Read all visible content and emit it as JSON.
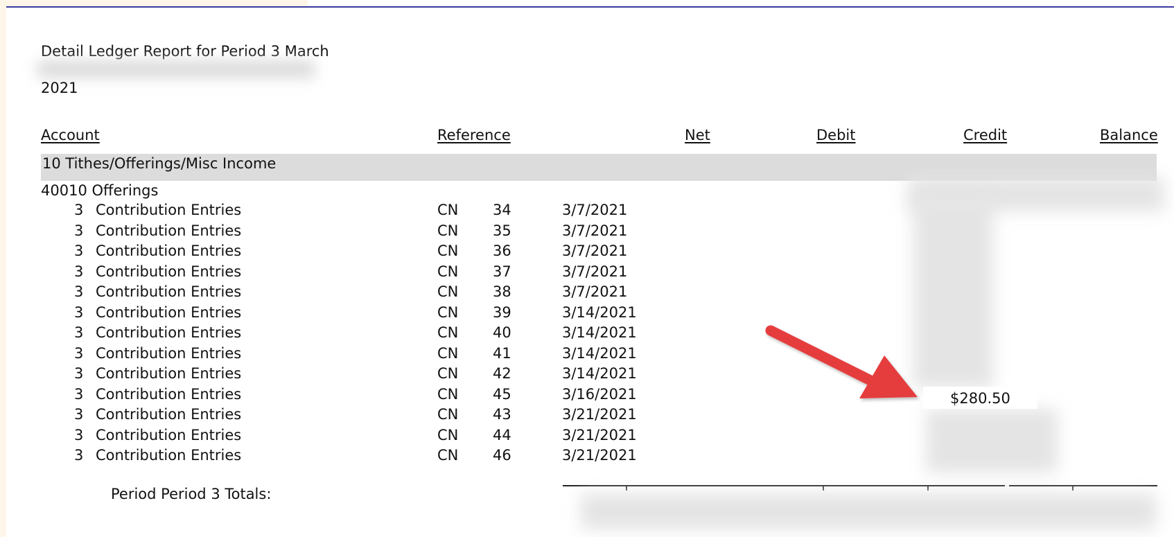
{
  "report": {
    "title": "Detail Ledger Report for Period 3 March",
    "year": "2021"
  },
  "columns": {
    "account": "Account",
    "reference": "Reference",
    "net": "Net",
    "debit": "Debit",
    "credit": "Credit",
    "balance": "Balance"
  },
  "group": {
    "label": "10 Tithes/Offerings/Misc Income"
  },
  "account": {
    "label": "40010 Offerings"
  },
  "rows": [
    {
      "period": "3",
      "description": "Contribution Entries",
      "type": "CN",
      "ref": "34",
      "date": "3/7/2021"
    },
    {
      "period": "3",
      "description": "Contribution Entries",
      "type": "CN",
      "ref": "35",
      "date": "3/7/2021"
    },
    {
      "period": "3",
      "description": "Contribution Entries",
      "type": "CN",
      "ref": "36",
      "date": "3/7/2021"
    },
    {
      "period": "3",
      "description": "Contribution Entries",
      "type": "CN",
      "ref": "37",
      "date": "3/7/2021"
    },
    {
      "period": "3",
      "description": "Contribution Entries",
      "type": "CN",
      "ref": "38",
      "date": "3/7/2021"
    },
    {
      "period": "3",
      "description": "Contribution Entries",
      "type": "CN",
      "ref": "39",
      "date": "3/14/2021"
    },
    {
      "period": "3",
      "description": "Contribution Entries",
      "type": "CN",
      "ref": "40",
      "date": "3/14/2021"
    },
    {
      "period": "3",
      "description": "Contribution Entries",
      "type": "CN",
      "ref": "41",
      "date": "3/14/2021"
    },
    {
      "period": "3",
      "description": "Contribution Entries",
      "type": "CN",
      "ref": "42",
      "date": "3/14/2021"
    },
    {
      "period": "3",
      "description": "Contribution Entries",
      "type": "CN",
      "ref": "45",
      "date": "3/16/2021",
      "credit": "$280.50"
    },
    {
      "period": "3",
      "description": "Contribution Entries",
      "type": "CN",
      "ref": "43",
      "date": "3/21/2021"
    },
    {
      "period": "3",
      "description": "Contribution Entries",
      "type": "CN",
      "ref": "44",
      "date": "3/21/2021"
    },
    {
      "period": "3",
      "description": "Contribution Entries",
      "type": "CN",
      "ref": "46",
      "date": "3/21/2021"
    }
  ],
  "totals": {
    "label": "Period Period 3 Totals:"
  },
  "colors": {
    "group_band": "#dcdcdc",
    "arrow": "#e53c3c",
    "top_rule": "#3a3aa0",
    "margin": "#fff6ea"
  },
  "icons": {
    "callout": "red-arrow-icon"
  }
}
